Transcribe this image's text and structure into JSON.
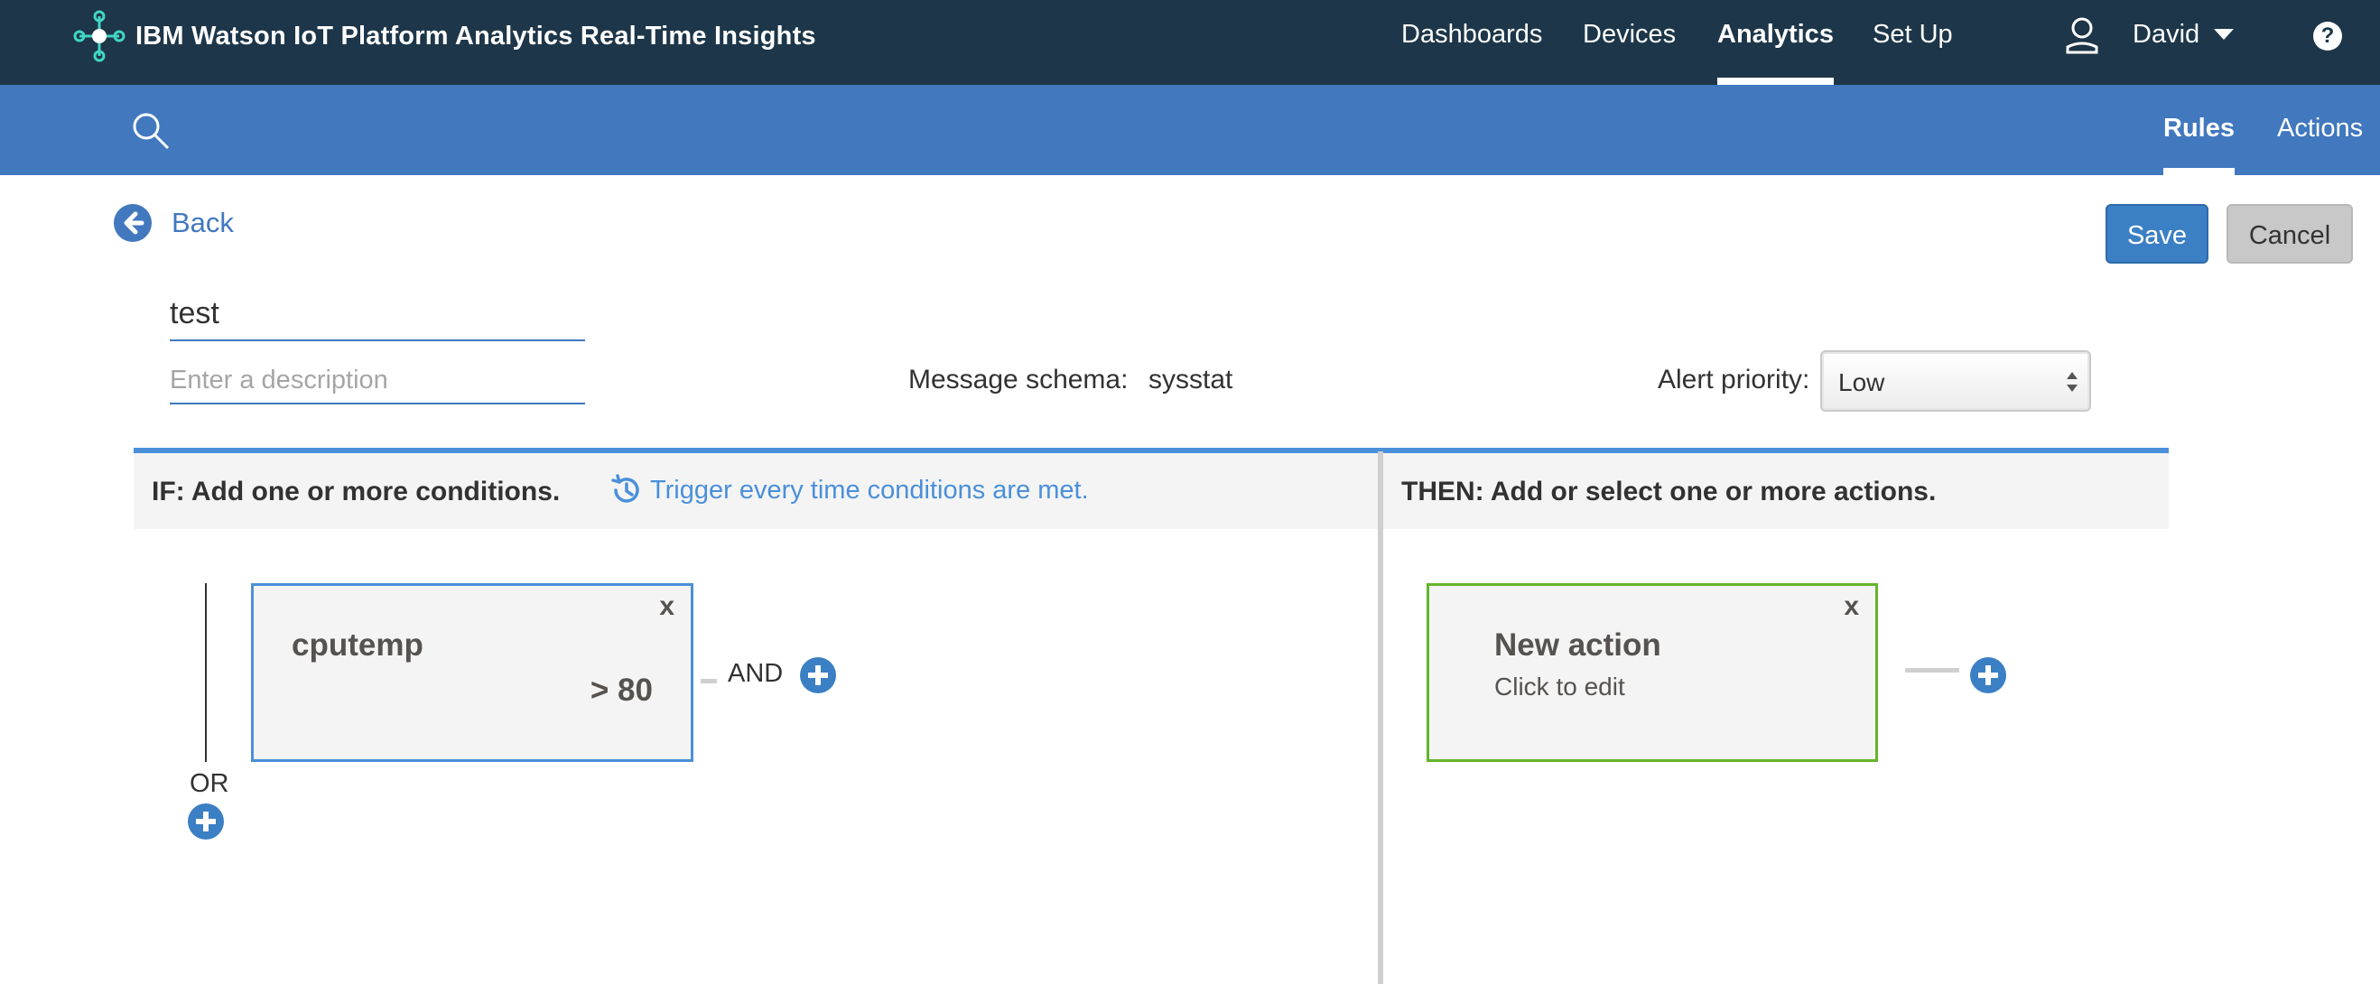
{
  "header": {
    "app_title": "IBM Watson IoT Platform Analytics Real-Time Insights",
    "nav": [
      {
        "label": "Dashboards",
        "active": false
      },
      {
        "label": "Devices",
        "active": false
      },
      {
        "label": "Analytics",
        "active": true
      },
      {
        "label": "Set Up",
        "active": false
      }
    ],
    "user_name": "David",
    "icons": {
      "logo": "iot-logo-icon",
      "user": "user-icon",
      "user_menu": "chevron-down-icon",
      "help": "help-icon"
    }
  },
  "subnav": {
    "search_icon": "search-icon",
    "tabs": [
      {
        "label": "Rules",
        "active": true
      },
      {
        "label": "Actions",
        "active": false
      }
    ]
  },
  "toolbar": {
    "back_label": "Back",
    "save_label": "Save",
    "cancel_label": "Cancel"
  },
  "rule": {
    "name": "test",
    "description_value": "",
    "description_placeholder": "Enter a description",
    "schema_label": "Message schema:",
    "schema_value": "sysstat",
    "priority_label": "Alert priority:",
    "priority_value": "Low"
  },
  "if_panel": {
    "title": "IF: Add one or more conditions.",
    "trigger_label": "Trigger every time conditions are met.",
    "conditions": [
      {
        "name": "cputemp",
        "value": "> 80",
        "close": "x"
      }
    ],
    "and_label": "AND",
    "or_label": "OR"
  },
  "then_panel": {
    "title": "THEN: Add or select one or more actions.",
    "actions": [
      {
        "title": "New action",
        "subtitle": "Click to edit",
        "close": "x"
      }
    ]
  },
  "colors": {
    "topbar": "#1d3649",
    "subbar": "#4178be",
    "accent": "#4a90d9",
    "primary_button": "#3b7fc4",
    "action_border": "#64b42d",
    "panel_bg": "#f4f4f4"
  }
}
